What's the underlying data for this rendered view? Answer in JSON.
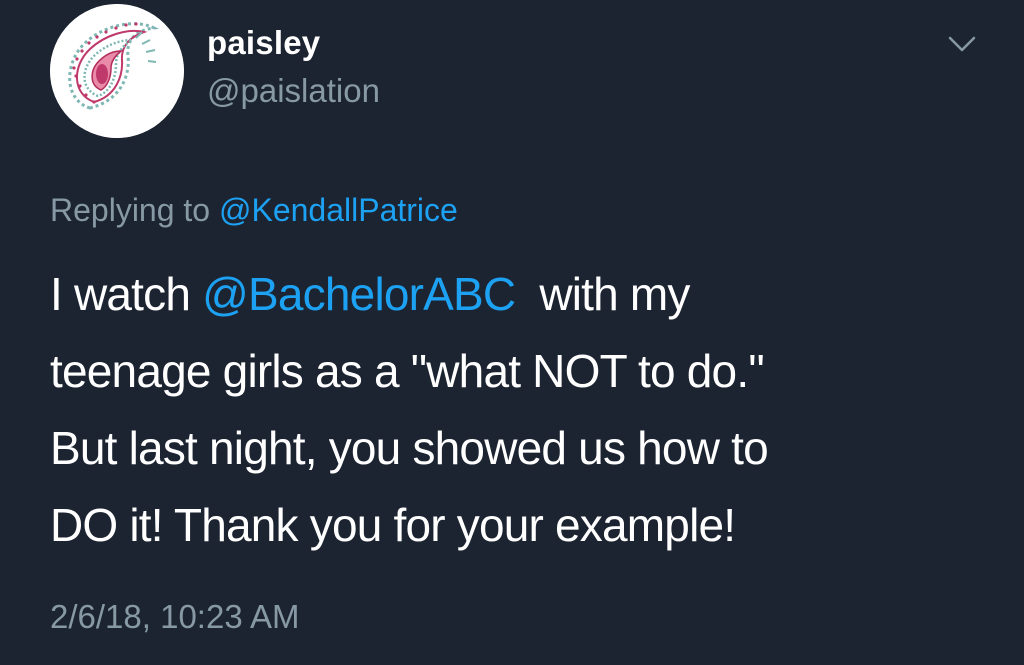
{
  "user": {
    "display_name": "paisley",
    "handle": "@paislation"
  },
  "reply": {
    "prefix": "Replying to",
    "to_handle": "@KendallPatrice"
  },
  "tweet": {
    "line1_pre": "I watch",
    "line1_mention": "@BachelorABC",
    "line1_post": "with my",
    "line2": "teenage girls as a \"what NOT to do.\"",
    "line3": "But last night, you showed us how to",
    "line4": "DO it!  Thank you for your example!"
  },
  "timestamp": "2/6/18, 10:23 AM",
  "icons": {
    "avatar": "paisley-avatar-icon",
    "menu": "chevron-down-icon"
  },
  "colors": {
    "background": "#1c2431",
    "text": "#ffffff",
    "secondary": "#8899a6",
    "link": "#1da1f2"
  }
}
